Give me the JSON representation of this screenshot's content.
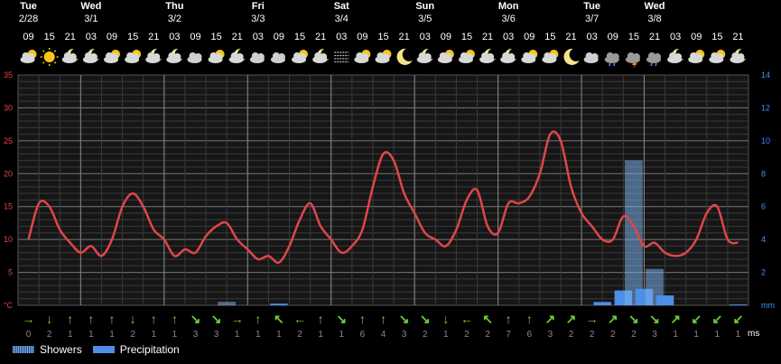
{
  "forecast": {
    "days": [
      {
        "name": "Tue",
        "date": "2/28",
        "col": 0
      },
      {
        "name": "Wed",
        "date": "3/1",
        "col": 3
      },
      {
        "name": "Thu",
        "date": "3/2",
        "col": 7
      },
      {
        "name": "Fri",
        "date": "3/3",
        "col": 11
      },
      {
        "name": "Sat",
        "date": "3/4",
        "col": 15
      },
      {
        "name": "Sun",
        "date": "3/5",
        "col": 19
      },
      {
        "name": "Mon",
        "date": "3/6",
        "col": 23
      },
      {
        "name": "Tue",
        "date": "3/7",
        "col": 27
      },
      {
        "name": "Wed",
        "date": "3/8",
        "col": 30
      }
    ],
    "hours": [
      "09",
      "15",
      "21",
      "03",
      "09",
      "15",
      "21",
      "03",
      "09",
      "15",
      "21",
      "03",
      "09",
      "15",
      "21",
      "03",
      "09",
      "15",
      "21",
      "03",
      "09",
      "15",
      "21",
      "03",
      "09",
      "15",
      "21",
      "03",
      "09",
      "15",
      "21",
      "03",
      "09",
      "15",
      "21"
    ],
    "icons": [
      "partly-cloudy-icon",
      "sun-icon",
      "partly-cloudy-night-icon",
      "partly-cloudy-night-icon",
      "partly-cloudy-icon",
      "partly-cloudy-icon",
      "partly-cloudy-night-icon",
      "partly-cloudy-night-icon",
      "cloud-icon",
      "partly-cloudy-icon",
      "partly-cloudy-night-icon",
      "cloud-icon",
      "cloud-icon",
      "partly-cloudy-icon",
      "partly-cloudy-night-icon",
      "fog-icon",
      "partly-cloudy-icon",
      "partly-cloudy-icon",
      "moon-icon",
      "partly-cloudy-night-icon",
      "partly-cloudy-icon",
      "partly-cloudy-icon",
      "partly-cloudy-night-icon",
      "partly-cloudy-night-icon",
      "partly-cloudy-icon",
      "partly-cloudy-icon",
      "moon-icon",
      "cloud-icon",
      "shower-cloud-icon",
      "thunder-cloud-icon",
      "shower-cloud-icon",
      "partly-cloudy-night-icon",
      "partly-cloudy-icon",
      "partly-cloudy-icon",
      "partly-cloudy-night-icon"
    ],
    "wind": {
      "directions": [
        "→",
        "↓",
        "↑",
        "↑",
        "↑",
        "↓",
        "↑",
        "↑",
        "↘",
        "↘",
        "→",
        "↑",
        "↖",
        "←",
        "↑",
        "↘",
        "↑",
        "↑",
        "↘",
        "↘",
        "↓",
        "←",
        "↖",
        "↑",
        "↑",
        "↗",
        "↗",
        "→",
        "↗",
        "↘",
        "↘",
        "↗",
        "↙",
        "↙",
        "↙"
      ],
      "speeds": [
        "0",
        "2",
        "1",
        "1",
        "1",
        "2",
        "1",
        "1",
        "3",
        "3",
        "1",
        "1",
        "1",
        "2",
        "1",
        "1",
        "6",
        "4",
        "3",
        "2",
        "1",
        "2",
        "2",
        "7",
        "6",
        "3",
        "2",
        "2",
        "2",
        "2",
        "3",
        "1",
        "1",
        "1",
        "1"
      ],
      "unit": "ms"
    },
    "colors": {
      "temperature": "#e0454a",
      "precip": "#4d8fe8",
      "shower": "#7aaee8",
      "axis_left": "#e0454a",
      "axis_right": "#3d8eff"
    }
  },
  "chart_data": {
    "type": "line",
    "x": [
      0,
      0.5,
      1,
      1.5,
      2,
      2.5,
      3,
      3.5,
      4,
      4.5,
      5,
      5.5,
      6,
      6.5,
      7,
      7.5,
      8,
      8.5,
      9,
      9.5,
      10,
      10.5,
      11,
      11.5,
      12,
      12.5,
      13,
      13.5,
      14,
      14.5,
      15,
      15.5,
      16,
      16.5,
      17,
      17.5,
      18,
      18.5,
      19,
      19.5,
      20,
      20.5,
      21,
      21.5,
      22,
      22.5,
      23,
      23.5,
      24,
      24.5,
      25,
      25.5,
      26,
      26.5,
      27,
      27.5,
      28,
      28.5,
      29,
      29.5,
      30,
      30.5,
      31,
      31.5,
      32,
      32.5,
      33,
      33.5,
      34
    ],
    "series": [
      {
        "values": [
          10,
          15.5,
          15,
          11.5,
          9.5,
          8,
          9,
          7.5,
          10,
          15,
          17,
          15,
          11.5,
          10,
          7.5,
          8.5,
          8,
          10.5,
          12,
          12.5,
          10,
          8.5,
          7,
          7.5,
          6.5,
          9,
          13,
          15.5,
          12,
          10,
          8,
          9,
          11.5,
          18,
          23,
          22,
          17,
          14,
          11,
          10,
          9,
          11.5,
          16,
          17.5,
          12,
          11,
          15.5,
          15.5,
          16.5,
          20,
          26,
          25,
          18,
          14,
          12,
          10,
          10,
          13.5,
          12,
          9,
          9.5,
          8,
          7.5,
          8,
          10,
          14,
          15,
          10,
          9.5
        ]
      },
      {
        "name": "Showers",
        "values": [
          0,
          0,
          0,
          0,
          0,
          0,
          0,
          0,
          0,
          0,
          0,
          0,
          0,
          0,
          0,
          0,
          0,
          0,
          0,
          0.2,
          0,
          0,
          0,
          0,
          0,
          0,
          0,
          0,
          0,
          0,
          0,
          0,
          0,
          0,
          0,
          0,
          0,
          0,
          0,
          0,
          0,
          0,
          0,
          0,
          0,
          0,
          0,
          0,
          0,
          0,
          0,
          0,
          0,
          0,
          0,
          0,
          0,
          0,
          8.8,
          0,
          2.2,
          0,
          0,
          0,
          0,
          0,
          0,
          0,
          0
        ]
      },
      {
        "name": "Precipitation",
        "values": [
          0,
          0,
          0,
          0,
          0,
          0,
          0,
          0,
          0,
          0,
          0,
          0,
          0,
          0,
          0,
          0,
          0,
          0,
          0,
          0,
          0,
          0,
          0,
          0,
          0.1,
          0,
          0,
          0,
          0,
          0,
          0,
          0,
          0,
          0,
          0,
          0,
          0,
          0,
          0,
          0,
          0,
          0,
          0,
          0,
          0,
          0,
          0,
          0,
          0,
          0,
          0,
          0,
          0,
          0,
          0,
          0.2,
          0,
          0.9,
          0,
          1.0,
          0,
          0.6,
          0,
          0,
          0,
          0,
          0,
          0,
          0.05
        ]
      }
    ],
    "yticks_left": [
      "35",
      "30",
      "25",
      "20",
      "15",
      "10",
      "5",
      "°C"
    ],
    "yticks_right": [
      "14",
      "12",
      "10",
      "8",
      "6",
      "4",
      "2",
      "mm"
    ],
    "ylim_left": [
      0,
      35
    ],
    "ylim_right": [
      0,
      14
    ],
    "grid": true,
    "legend": "bottom-left"
  },
  "legend": {
    "showers": "Showers",
    "precipitation": "Precipitation"
  }
}
